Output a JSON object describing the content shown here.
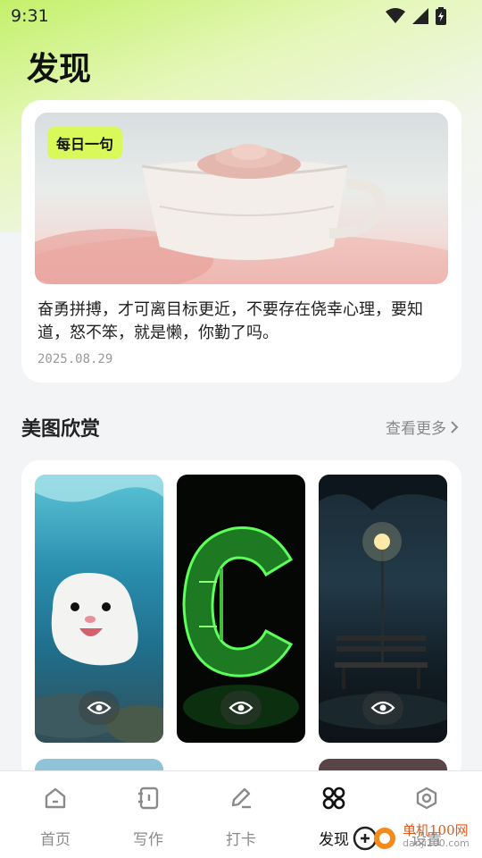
{
  "status_bar": {
    "time": "9:31"
  },
  "page": {
    "title": "发现"
  },
  "quote_card": {
    "badge": "每日一句",
    "text": "奋勇拼搏，才可离目标更近，不要存在侥幸心理，要知道，怒不笨，就是懒，你勤了吗。",
    "date": "2025.08.29"
  },
  "gallery": {
    "title": "美图欣赏",
    "see_more": "查看更多"
  },
  "tabs": [
    {
      "label": "首页",
      "icon": "home-icon"
    },
    {
      "label": "写作",
      "icon": "notebook-icon"
    },
    {
      "label": "打卡",
      "icon": "pen-icon"
    },
    {
      "label": "发现",
      "icon": "grid-icon"
    },
    {
      "label": "设置",
      "icon": "settings-icon"
    }
  ],
  "watermark": {
    "name": "单机100网",
    "url": "danji100.com"
  },
  "colors": {
    "accent": "#d9f95a",
    "active_tab": "#111111",
    "inactive_tab": "#8a8a8a"
  }
}
